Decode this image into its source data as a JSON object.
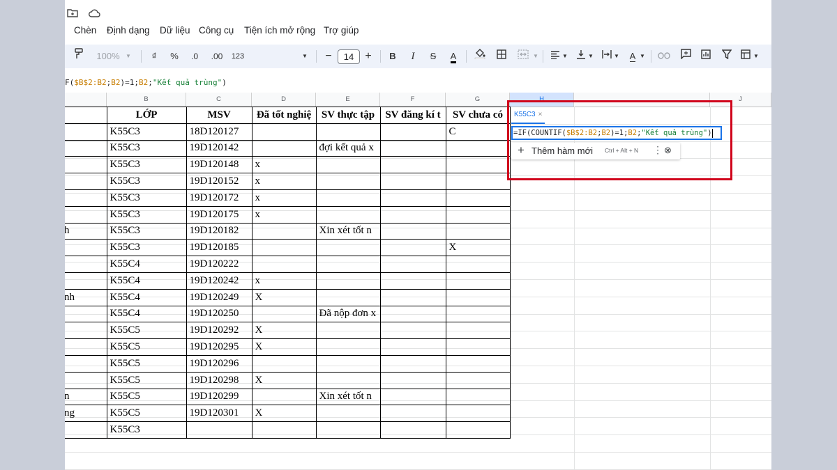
{
  "menu": [
    "Chèn",
    "Định dạng",
    "Dữ liệu",
    "Công cụ",
    "Tiện ích mở rộng",
    "Trợ giúp"
  ],
  "toolbar": {
    "zoom": "100%",
    "currency": "₫",
    "percent": "%",
    "dec_decrease": ".0",
    "dec_increase": ".00",
    "number_format": "123",
    "font_size": "14",
    "minus": "−",
    "plus": "+",
    "bold": "B",
    "italic": "I",
    "strike": "S",
    "text_color": "A",
    "text_color_2": "A"
  },
  "formula_bar": {
    "p1": "F(",
    "p2": "$B$2:B2",
    "p3": ";",
    "p4": "B2",
    "p5": ")=1;",
    "p6": "B2",
    "p7": ";",
    "p8": "\"Kết quả trùng\"",
    "p9": ")"
  },
  "columns": [
    "B",
    "C",
    "D",
    "E",
    "F",
    "G",
    "H",
    "J"
  ],
  "table": {
    "headers": [
      "LỚP",
      "MSV",
      "Đã tốt nghiệ",
      "SV thực tập",
      "SV đăng kí t",
      "SV chưa có"
    ],
    "rows": [
      [
        "",
        "K55C3",
        "18D120127",
        "",
        "",
        "",
        "C"
      ],
      [
        "",
        "K55C3",
        "19D120142",
        "",
        "đợi kết quả x",
        "",
        ""
      ],
      [
        "",
        "K55C3",
        "19D120148",
        "x",
        "",
        "",
        ""
      ],
      [
        "",
        "K55C3",
        "19D120152",
        "x",
        "",
        "",
        ""
      ],
      [
        "",
        "K55C3",
        "19D120172",
        "x",
        "",
        "",
        ""
      ],
      [
        "",
        "K55C3",
        "19D120175",
        "x",
        "",
        "",
        ""
      ],
      [
        "h",
        "K55C3",
        "19D120182",
        "",
        "Xin xét tốt n",
        "",
        ""
      ],
      [
        "",
        "K55C3",
        "19D120185",
        "",
        "",
        "",
        "X"
      ],
      [
        "",
        "K55C4",
        "19D120222",
        "",
        "",
        "",
        ""
      ],
      [
        "",
        "K55C4",
        "19D120242",
        "x",
        "",
        "",
        ""
      ],
      [
        "nh",
        "K55C4",
        "19D120249",
        "X",
        "",
        "",
        ""
      ],
      [
        "",
        "K55C4",
        "19D120250",
        "",
        "Đã nộp đơn x",
        "",
        ""
      ],
      [
        "",
        "K55C5",
        "19D120292",
        "X",
        "",
        "",
        ""
      ],
      [
        "",
        "K55C5",
        "19D120295",
        "X",
        "",
        "",
        ""
      ],
      [
        "",
        "K55C5",
        "19D120296",
        "",
        "",
        "",
        ""
      ],
      [
        "",
        "K55C5",
        "19D120298",
        "X",
        "",
        "",
        ""
      ],
      [
        "n",
        "K55C5",
        "19D120299",
        "",
        "Xin xét tốt n",
        "",
        ""
      ],
      [
        "ng",
        "K55C5",
        "19D120301",
        "X",
        "",
        "",
        ""
      ],
      [
        "",
        "K55C3",
        "",
        "",
        "",
        "",
        ""
      ]
    ]
  },
  "editor": {
    "chip_label": "K55C3",
    "chip_close": "×",
    "f1": "=IF(COUNTIF(",
    "f2": "$B$2:B2",
    "f3": ";",
    "f4": "B2",
    "f5": ")=1;",
    "f6": "B2",
    "f7": ";",
    "f8": "\"Kết quả trùng\"",
    "f9": ")"
  },
  "suggestion": {
    "plus": "+",
    "label": "Thêm hàm mới",
    "shortcut": "Ctrl + Alt + N",
    "more": "⋮",
    "close": "⊗"
  },
  "colors": {
    "highlight_box": "#d0021b",
    "selection_blue": "#1a73e8",
    "toolbar_bg": "#eef2fa"
  }
}
